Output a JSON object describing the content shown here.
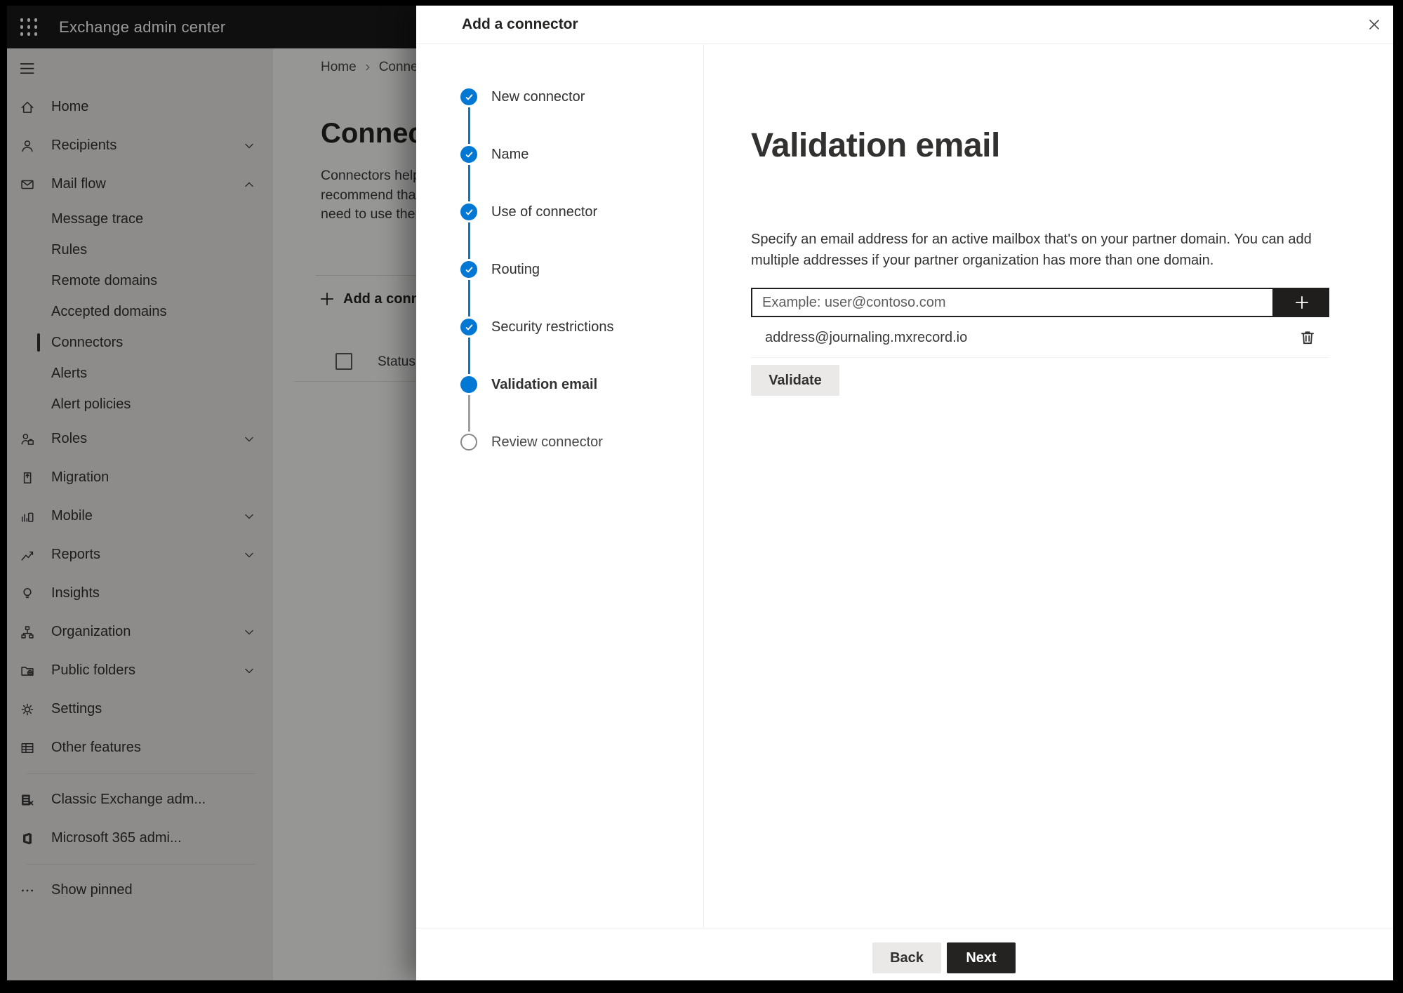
{
  "app": {
    "title": "Exchange admin center"
  },
  "background_page": {
    "breadcrumb": {
      "home": "Home",
      "current": "Conne"
    },
    "title": "Connec",
    "description_lines": [
      "Connectors help",
      "recommend tha",
      "need to use ther"
    ],
    "add_button_label": "Add a conn",
    "status_header": "Status"
  },
  "sidebar": {
    "items": [
      {
        "label": "Home",
        "icon": "home"
      },
      {
        "label": "Recipients",
        "icon": "person",
        "chevron": "down"
      },
      {
        "label": "Mail flow",
        "icon": "mail",
        "chevron": "up"
      },
      {
        "label": "Message trace",
        "sub": true
      },
      {
        "label": "Rules",
        "sub": true
      },
      {
        "label": "Remote domains",
        "sub": true
      },
      {
        "label": "Accepted domains",
        "sub": true
      },
      {
        "label": "Connectors",
        "sub": true,
        "selected": true
      },
      {
        "label": "Alerts",
        "sub": true
      },
      {
        "label": "Alert policies",
        "sub": true
      },
      {
        "label": "Roles",
        "icon": "roles",
        "chevron": "down"
      },
      {
        "label": "Migration",
        "icon": "migration"
      },
      {
        "label": "Mobile",
        "icon": "mobile",
        "chevron": "down"
      },
      {
        "label": "Reports",
        "icon": "reports",
        "chevron": "down"
      },
      {
        "label": "Insights",
        "icon": "insights"
      },
      {
        "label": "Organization",
        "icon": "organization",
        "chevron": "down"
      },
      {
        "label": "Public folders",
        "icon": "public-folders",
        "chevron": "down"
      },
      {
        "label": "Settings",
        "icon": "settings"
      },
      {
        "label": "Other features",
        "icon": "other-features"
      },
      {
        "divider": true
      },
      {
        "label": "Classic Exchange adm...",
        "icon": "exchange"
      },
      {
        "label": "Microsoft 365 admi...",
        "icon": "office"
      },
      {
        "divider": true
      },
      {
        "label": "Show pinned",
        "icon": "ellipsis"
      }
    ]
  },
  "modal": {
    "title": "Add a connector",
    "steps": [
      {
        "label": "New connector",
        "state": "complete"
      },
      {
        "label": "Name",
        "state": "complete"
      },
      {
        "label": "Use of connector",
        "state": "complete"
      },
      {
        "label": "Routing",
        "state": "complete"
      },
      {
        "label": "Security restrictions",
        "state": "complete"
      },
      {
        "label": "Validation email",
        "state": "current"
      },
      {
        "label": "Review connector",
        "state": "upcoming"
      }
    ],
    "heading": "Validation email",
    "description_lines": [
      "Specify an email address for an active mailbox that's on your partner domain. You can add",
      "multiple addresses if your partner organization has more than one domain."
    ],
    "email_input": {
      "value": "",
      "placeholder": "Example: user@contoso.com"
    },
    "addresses": [
      "address@journaling.mxrecord.io"
    ],
    "validate_button": "Validate",
    "back_button": "Back",
    "next_button": "Next"
  },
  "icons": {
    "waffle": "3x3 white dots",
    "hamburger": "three horizontal lines",
    "close": "thin X",
    "checkmark": "white check in blue circle",
    "plus": "+",
    "trash": "trash can outline",
    "chevron": "v / ^ expander arrows"
  },
  "colors": {
    "accent_blue": "#0078d4",
    "appbar_bg": "#1b1a19",
    "dark_button": "#242322",
    "light_button": "#ebe9e7",
    "text_primary": "#323130"
  }
}
